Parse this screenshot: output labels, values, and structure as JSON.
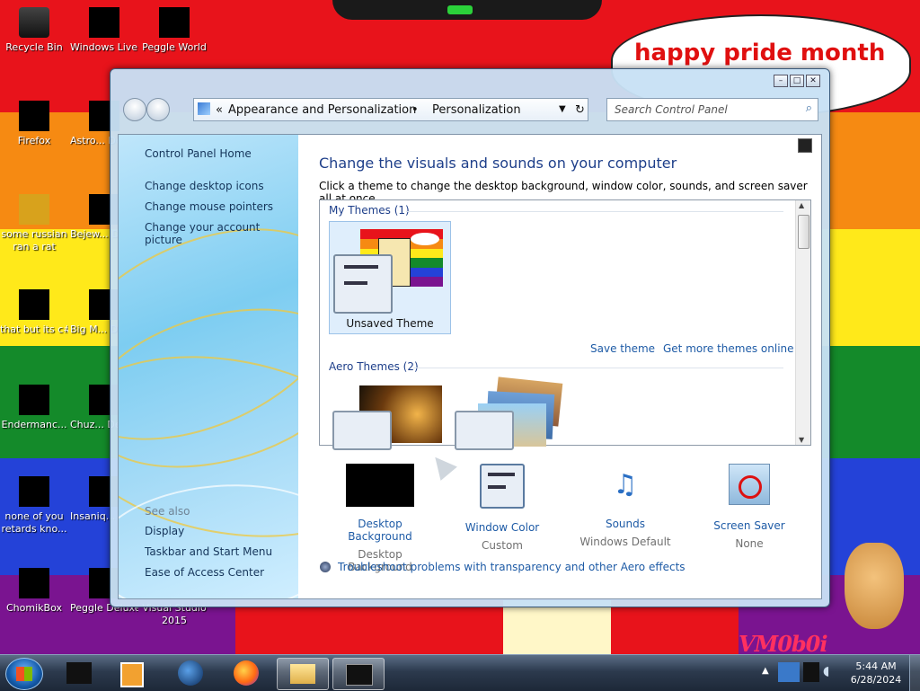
{
  "speech_bubble": "happy pride month",
  "signature": "VM0b0i",
  "desktop_icons": [
    {
      "label": "Recycle Bin"
    },
    {
      "label": "Windows Live Mai..."
    },
    {
      "label": "Peggle World"
    },
    {
      "label": "Firefox"
    },
    {
      "label": "Astro... Delu..."
    },
    {
      "label": "some russian ran a rat"
    },
    {
      "label": "Bejew... Delu..."
    },
    {
      "label": "that but its c#"
    },
    {
      "label": "Big M... Delu..."
    },
    {
      "label": "Endermanc..."
    },
    {
      "label": "Chuz... Delu..."
    },
    {
      "label": "none of you retards kno..."
    },
    {
      "label": "Insaniq... Delu..."
    },
    {
      "label": "ChomikBox"
    },
    {
      "label": "Peggle Deluxe"
    },
    {
      "label": "Visual Studio 2015"
    }
  ],
  "window": {
    "breadcrumb": [
      "Appearance and Personalization",
      "Personalization"
    ],
    "breadcrumb_prefix": "«",
    "search_placeholder": "Search Control Panel",
    "sidebar": {
      "links": [
        "Control Panel Home",
        "Change desktop icons",
        "Change mouse pointers",
        "Change your account picture"
      ],
      "see_also_label": "See also",
      "see_also": [
        "Display",
        "Taskbar and Start Menu",
        "Ease of Access Center"
      ]
    },
    "heading": "Change the visuals and sounds on your computer",
    "subheading": "Click a theme to change the desktop background, window color, sounds, and screen saver all at once.",
    "my_themes_label": "My Themes (1)",
    "unsaved_theme": "Unsaved Theme",
    "save_theme": "Save theme",
    "get_more_themes": "Get more themes online",
    "aero_themes_label": "Aero Themes (2)",
    "bottom": [
      {
        "title": "Desktop Background",
        "value": "Desktop Background"
      },
      {
        "title": "Window Color",
        "value": "Custom"
      },
      {
        "title": "Sounds",
        "value": "Windows Default"
      },
      {
        "title": "Screen Saver",
        "value": "None"
      }
    ],
    "troubleshoot": "Troubleshoot problems with transparency and other Aero effects"
  },
  "taskbar": {
    "time": "5:44 AM",
    "date": "6/28/2024"
  },
  "colors": {
    "link": "#1e5ba6",
    "heading": "#1e3f8a",
    "speech": "#e01010"
  }
}
